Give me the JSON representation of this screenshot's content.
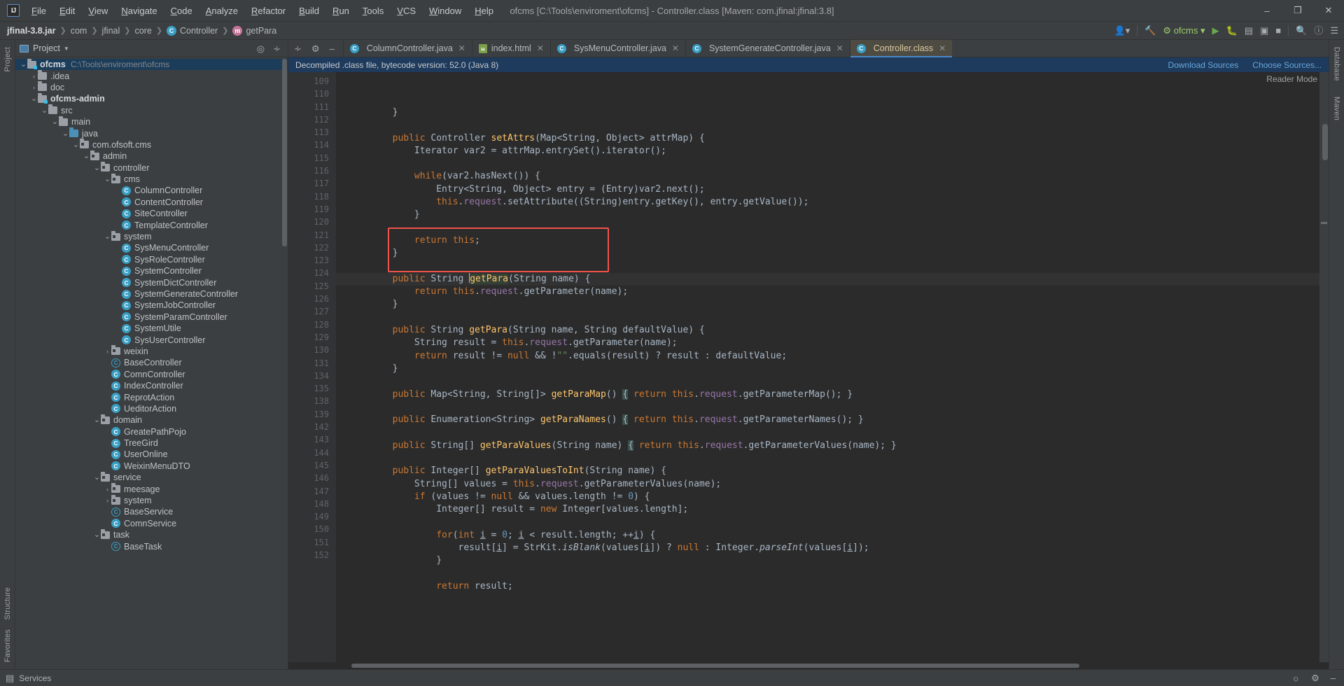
{
  "window": {
    "title": "ofcms [C:\\Tools\\enviroment\\ofcms] - Controller.class [Maven: com.jfinal:jfinal:3.8]",
    "minimize": "–",
    "maximize": "❐",
    "close": "✕"
  },
  "menu": [
    {
      "label": "File"
    },
    {
      "label": "Edit"
    },
    {
      "label": "View"
    },
    {
      "label": "Navigate"
    },
    {
      "label": "Code"
    },
    {
      "label": "Analyze"
    },
    {
      "label": "Refactor"
    },
    {
      "label": "Build"
    },
    {
      "label": "Run"
    },
    {
      "label": "Tools"
    },
    {
      "label": "VCS"
    },
    {
      "label": "Window"
    },
    {
      "label": "Help"
    }
  ],
  "breadcrumb": [
    {
      "label": "jfinal-3.8.jar",
      "icon": "none"
    },
    {
      "label": "com",
      "icon": "none"
    },
    {
      "label": "jfinal",
      "icon": "none"
    },
    {
      "label": "core",
      "icon": "none"
    },
    {
      "label": "Controller",
      "icon": "class-badge"
    },
    {
      "label": "getPara",
      "icon": "method-badge"
    }
  ],
  "breadcrumb_icons": {
    "class": "C",
    "method": "m"
  },
  "sidebar_strips": {
    "left_top": "Project",
    "left_bottom_1": "Structure",
    "left_bottom_2": "Favorites",
    "right_1": "Database",
    "right_2": "Maven"
  },
  "project_panel": {
    "title": "Project",
    "locate_icon": "crosshair-icon",
    "collapse_icon": "collapse-all-icon",
    "tree": [
      {
        "depth": 0,
        "label": "ofcms",
        "path": "C:\\Tools\\enviroment\\ofcms",
        "icon": "module",
        "arrow": "down",
        "bold": true,
        "selected": true
      },
      {
        "depth": 1,
        "label": ".idea",
        "icon": "folder",
        "arrow": "right"
      },
      {
        "depth": 1,
        "label": "doc",
        "icon": "folder",
        "arrow": "right"
      },
      {
        "depth": 1,
        "label": "ofcms-admin",
        "icon": "module",
        "arrow": "down",
        "bold": true
      },
      {
        "depth": 2,
        "label": "src",
        "icon": "folder",
        "arrow": "down"
      },
      {
        "depth": 3,
        "label": "main",
        "icon": "folder",
        "arrow": "down"
      },
      {
        "depth": 4,
        "label": "java",
        "icon": "folder-blue",
        "arrow": "down"
      },
      {
        "depth": 5,
        "label": "com.ofsoft.cms",
        "icon": "package",
        "arrow": "down"
      },
      {
        "depth": 6,
        "label": "admin",
        "icon": "package",
        "arrow": "down"
      },
      {
        "depth": 7,
        "label": "controller",
        "icon": "package",
        "arrow": "down"
      },
      {
        "depth": 8,
        "label": "cms",
        "icon": "package",
        "arrow": "down"
      },
      {
        "depth": 9,
        "label": "ColumnController",
        "icon": "class",
        "arrow": "none"
      },
      {
        "depth": 9,
        "label": "ContentController",
        "icon": "class",
        "arrow": "none"
      },
      {
        "depth": 9,
        "label": "SiteController",
        "icon": "class",
        "arrow": "none"
      },
      {
        "depth": 9,
        "label": "TemplateController",
        "icon": "class",
        "arrow": "none"
      },
      {
        "depth": 8,
        "label": "system",
        "icon": "package",
        "arrow": "down"
      },
      {
        "depth": 9,
        "label": "SysMenuController",
        "icon": "class",
        "arrow": "none"
      },
      {
        "depth": 9,
        "label": "SysRoleController",
        "icon": "class",
        "arrow": "none"
      },
      {
        "depth": 9,
        "label": "SystemController",
        "icon": "class",
        "arrow": "none"
      },
      {
        "depth": 9,
        "label": "SystemDictController",
        "icon": "class",
        "arrow": "none"
      },
      {
        "depth": 9,
        "label": "SystemGenerateController",
        "icon": "class",
        "arrow": "none"
      },
      {
        "depth": 9,
        "label": "SystemJobController",
        "icon": "class",
        "arrow": "none"
      },
      {
        "depth": 9,
        "label": "SystemParamController",
        "icon": "class",
        "arrow": "none"
      },
      {
        "depth": 9,
        "label": "SystemUtile",
        "icon": "class",
        "arrow": "none"
      },
      {
        "depth": 9,
        "label": "SysUserController",
        "icon": "class",
        "arrow": "none"
      },
      {
        "depth": 8,
        "label": "weixin",
        "icon": "package",
        "arrow": "right"
      },
      {
        "depth": 8,
        "label": "BaseController",
        "icon": "class-abstract",
        "arrow": "none"
      },
      {
        "depth": 8,
        "label": "ComnController",
        "icon": "class",
        "arrow": "none"
      },
      {
        "depth": 8,
        "label": "IndexController",
        "icon": "class",
        "arrow": "none"
      },
      {
        "depth": 8,
        "label": "ReprotAction",
        "icon": "class",
        "arrow": "none"
      },
      {
        "depth": 8,
        "label": "UeditorAction",
        "icon": "class",
        "arrow": "none"
      },
      {
        "depth": 7,
        "label": "domain",
        "icon": "package",
        "arrow": "down"
      },
      {
        "depth": 8,
        "label": "GreatePathPojo",
        "icon": "class",
        "arrow": "none"
      },
      {
        "depth": 8,
        "label": "TreeGird",
        "icon": "class",
        "arrow": "none"
      },
      {
        "depth": 8,
        "label": "UserOnline",
        "icon": "class",
        "arrow": "none"
      },
      {
        "depth": 8,
        "label": "WeixinMenuDTO",
        "icon": "class",
        "arrow": "none"
      },
      {
        "depth": 7,
        "label": "service",
        "icon": "package",
        "arrow": "down"
      },
      {
        "depth": 8,
        "label": "meesage",
        "icon": "package",
        "arrow": "right"
      },
      {
        "depth": 8,
        "label": "system",
        "icon": "package",
        "arrow": "right"
      },
      {
        "depth": 8,
        "label": "BaseService",
        "icon": "class-abstract",
        "arrow": "none"
      },
      {
        "depth": 8,
        "label": "ComnService",
        "icon": "class",
        "arrow": "none"
      },
      {
        "depth": 7,
        "label": "task",
        "icon": "package",
        "arrow": "down"
      },
      {
        "depth": 8,
        "label": "BaseTask",
        "icon": "class-abstract",
        "arrow": "none"
      }
    ]
  },
  "editor": {
    "tabs": [
      {
        "label": "ColumnController.java",
        "icon": "class",
        "active": false,
        "closable": true
      },
      {
        "label": "index.html",
        "icon": "html",
        "active": false,
        "closable": true
      },
      {
        "label": "SysMenuController.java",
        "icon": "class",
        "active": false,
        "closable": true
      },
      {
        "label": "SystemGenerateController.java",
        "icon": "class",
        "active": false,
        "closable": true
      },
      {
        "label": "Controller.class",
        "icon": "class",
        "active": true,
        "closable": true
      }
    ],
    "tab_toolbar": {
      "collapse_icon": "collapse-all-icon",
      "settings_icon": "gear-icon",
      "hide_icon": "minimize-icon"
    },
    "notice": {
      "text": "Decompiled .class file, bytecode version: 52.0 (Java 8)",
      "download_sources": "Download Sources",
      "choose_sources": "Choose Sources..."
    },
    "reader_mode": "Reader Mode",
    "lines": [
      {
        "num": "109",
        "fold": "end",
        "html": "        }"
      },
      {
        "num": "110",
        "fold": "",
        "html": ""
      },
      {
        "num": "111",
        "fold": "start",
        "html": "        <span class=\"kw\">public</span> Controller <span class=\"mth\">setAttrs</span>(Map&lt;String, Object&gt; attrMap) {"
      },
      {
        "num": "112",
        "fold": "",
        "html": "            Iterator var2 = attrMap.entrySet().iterator();"
      },
      {
        "num": "113",
        "fold": "",
        "html": ""
      },
      {
        "num": "114",
        "fold": "start",
        "html": "            <span class=\"kw\">while</span>(var2.hasNext()) {"
      },
      {
        "num": "115",
        "fold": "",
        "html": "                Entry&lt;String, Object&gt; entry = (Entry)var2.next();"
      },
      {
        "num": "116",
        "fold": "",
        "html": "                <span class=\"kw\">this</span>.<span class=\"fld\">request</span>.setAttribute((String)entry.getKey(), entry.getValue());"
      },
      {
        "num": "117",
        "fold": "end",
        "html": "            }"
      },
      {
        "num": "118",
        "fold": "",
        "html": ""
      },
      {
        "num": "119",
        "fold": "",
        "html": "            <span class=\"kw\">return this</span>;"
      },
      {
        "num": "120",
        "fold": "end",
        "html": "        }"
      },
      {
        "num": "121",
        "fold": "",
        "html": ""
      },
      {
        "num": "122",
        "fold": "start",
        "html": "        <span class=\"kw\">public</span> String <span class=\"caret\"></span><span class=\"cursorword mth\">getPara</span>(String name) {",
        "highlight": true
      },
      {
        "num": "123",
        "fold": "",
        "html": "            <span class=\"kw\">return this</span>.<span class=\"fld\">request</span>.getParameter(name);"
      },
      {
        "num": "124",
        "fold": "end",
        "html": "        }"
      },
      {
        "num": "125",
        "fold": "",
        "html": ""
      },
      {
        "num": "126",
        "fold": "start",
        "html": "        <span class=\"kw\">public</span> String <span class=\"mth\">getPara</span>(String name, String defaultValue) {"
      },
      {
        "num": "127",
        "fold": "",
        "html": "            String result = <span class=\"kw\">this</span>.<span class=\"fld\">request</span>.getParameter(name);"
      },
      {
        "num": "128",
        "fold": "",
        "html": "            <span class=\"kw\">return</span> result != <span class=\"kw\">null</span> &amp;&amp; !<span class=\"str\">\"\"</span>.equals(result) ? result : defaultValue;"
      },
      {
        "num": "129",
        "fold": "end",
        "html": "        }"
      },
      {
        "num": "130",
        "fold": "",
        "html": ""
      },
      {
        "num": "131",
        "fold": "plus",
        "html": "        <span class=\"kw\">public</span> Map&lt;String, String[]&gt; <span class=\"mth\">getParaMap</span>() <span class=\"brace-hl\">{</span> <span class=\"kw\">return this</span>.<span class=\"fld\">request</span>.getParameterMap(); }"
      },
      {
        "num": "134",
        "fold": "",
        "html": ""
      },
      {
        "num": "135",
        "fold": "plus",
        "html": "        <span class=\"kw\">public</span> Enumeration&lt;String&gt; <span class=\"mth\">getParaNames</span>() <span class=\"brace-hl\">{</span> <span class=\"kw\">return this</span>.<span class=\"fld\">request</span>.getParameterNames(); }"
      },
      {
        "num": "138",
        "fold": "",
        "html": ""
      },
      {
        "num": "139",
        "fold": "plus",
        "html": "        <span class=\"kw\">public</span> String[] <span class=\"mth\">getParaValues</span>(String name) <span class=\"brace-hl\">{</span> <span class=\"kw\">return this</span>.<span class=\"fld\">request</span>.getParameterValues(name); }"
      },
      {
        "num": "142",
        "fold": "",
        "html": ""
      },
      {
        "num": "143",
        "fold": "start",
        "html": "        <span class=\"kw\">public</span> Integer[] <span class=\"mth\">getParaValuesToInt</span>(String name) {"
      },
      {
        "num": "144",
        "fold": "",
        "html": "            String[] values = <span class=\"kw\">this</span>.<span class=\"fld\">request</span>.getParameterValues(name);"
      },
      {
        "num": "145",
        "fold": "start",
        "html": "            <span class=\"kw\">if</span> (values != <span class=\"kw\">null</span> &amp;&amp; values.length != <span class=\"num\">0</span>) {"
      },
      {
        "num": "146",
        "fold": "",
        "html": "                Integer[] result = <span class=\"kw\">new</span> Integer[values.length];"
      },
      {
        "num": "147",
        "fold": "",
        "html": ""
      },
      {
        "num": "148",
        "fold": "start",
        "html": "                <span class=\"kw\">for</span>(<span class=\"kw\">int</span> <span style=\"text-decoration:underline\">i</span> = <span class=\"num\">0</span>; <span style=\"text-decoration:underline\">i</span> &lt; result.length; ++<span style=\"text-decoration:underline\">i</span>) {"
      },
      {
        "num": "149",
        "fold": "",
        "html": "                    result[<span style=\"text-decoration:underline\">i</span>] = StrKit.<span style=\"font-style:italic\">isBlank</span>(values[<span style=\"text-decoration:underline\">i</span>]) ? <span class=\"kw\">null</span> : Integer.<span style=\"font-style:italic\">parseInt</span>(values[<span style=\"text-decoration:underline\">i</span>]);"
      },
      {
        "num": "150",
        "fold": "end",
        "html": "                }"
      },
      {
        "num": "151",
        "fold": "",
        "html": ""
      },
      {
        "num": "152",
        "fold": "",
        "html": "                <span class=\"kw\">return</span> result;"
      }
    ]
  },
  "statusbar": {
    "services": "Services",
    "event_log_icon": "event-log-icon",
    "settings_icon": "gear-icon",
    "hide_icon": "hide-icon"
  },
  "colors": {
    "accent": "#4a88c7",
    "highlight_box": "#f0524c",
    "notice_bg": "#1e3a5c",
    "selection": "#1c3d5a",
    "editor_bg": "#2b2b2b",
    "panel_bg": "#3c3f41"
  }
}
